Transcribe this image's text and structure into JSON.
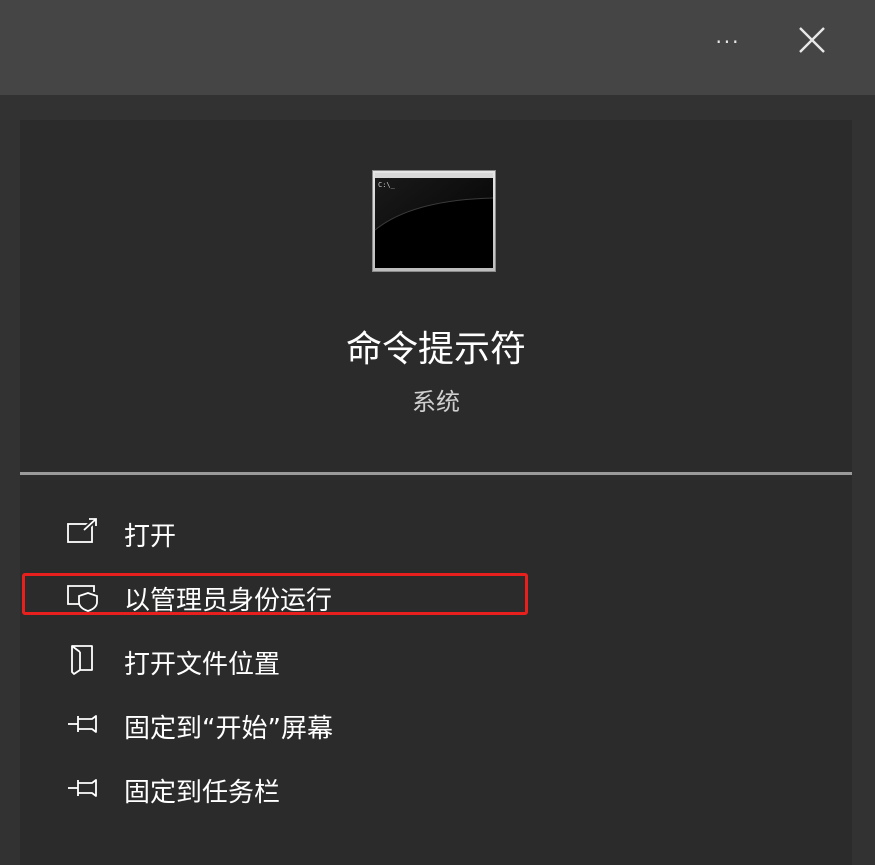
{
  "header": {
    "more_label": "···",
    "more_icon": "more-icon",
    "close_icon": "close-icon"
  },
  "app": {
    "icon": "command-prompt-icon",
    "icon_text": "C:\\_",
    "title": "命令提示符",
    "subtitle": "系统"
  },
  "menu": {
    "items": [
      {
        "label": "打开",
        "icon": "open-icon"
      },
      {
        "label": "以管理员身份运行",
        "icon": "shield-icon"
      },
      {
        "label": "打开文件位置",
        "icon": "file-location-icon"
      },
      {
        "label": "固定到“开始”屏幕",
        "icon": "pin-icon"
      },
      {
        "label": "固定到任务栏",
        "icon": "pin-icon"
      }
    ],
    "highlighted_index": 1
  },
  "colors": {
    "highlight": "#e8201d",
    "background": "#2b2b2b",
    "topbar": "#454545"
  }
}
